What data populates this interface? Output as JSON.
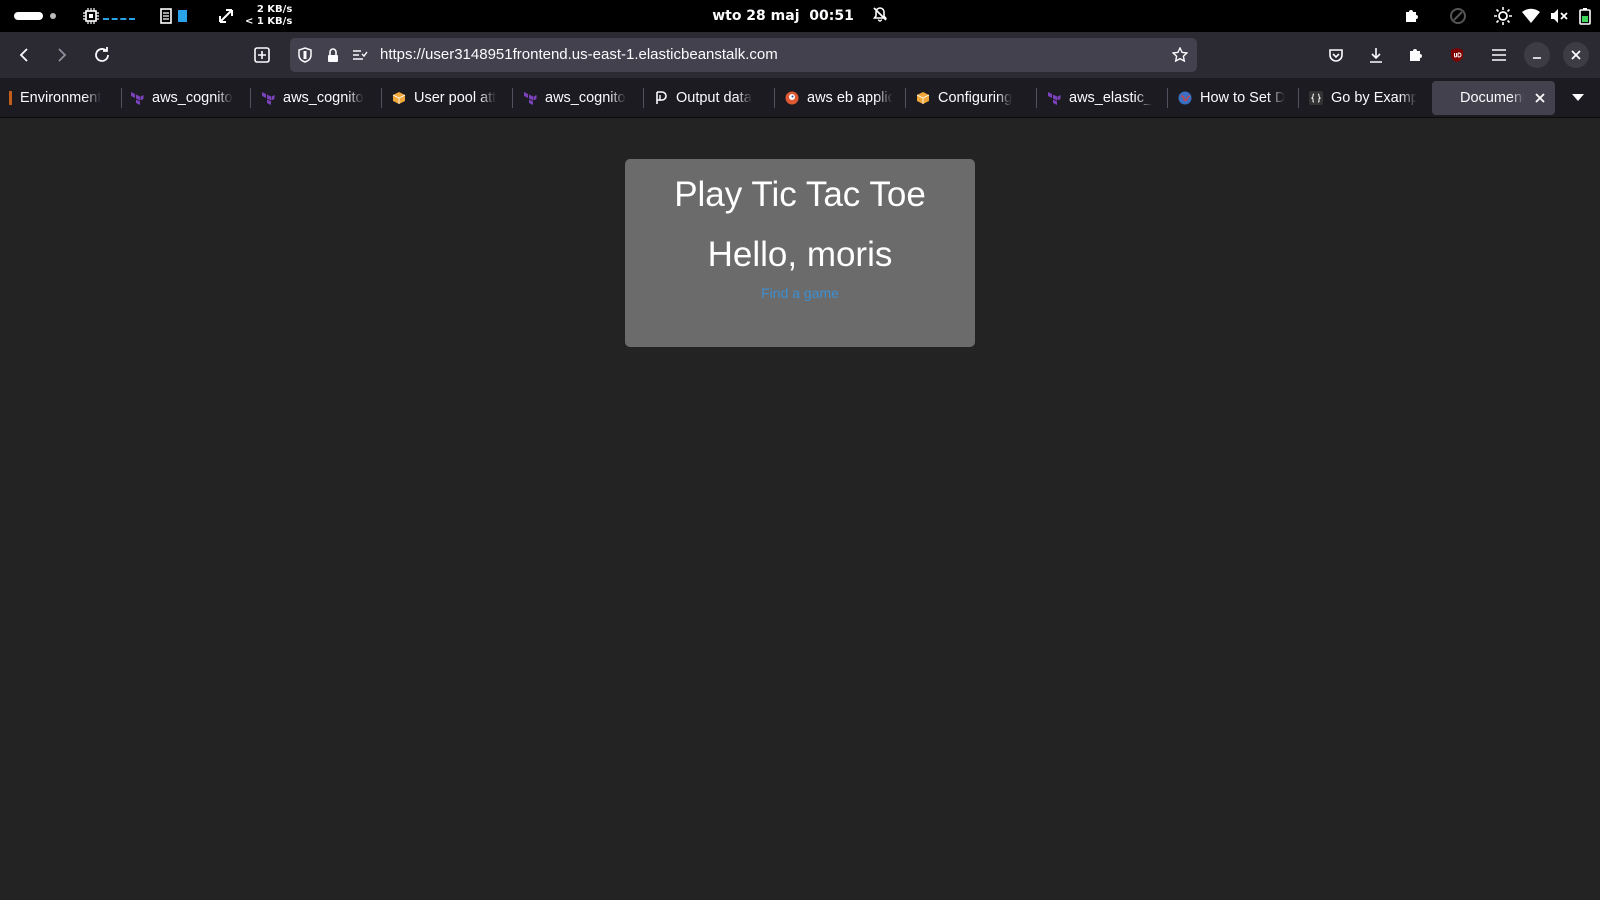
{
  "system_bar": {
    "net_up": "2 KB/s",
    "net_down": "< 1 KB/s",
    "datetime": "wto 28 maj  00:51",
    "accent_color": "#29a3e6"
  },
  "browser": {
    "url": "https://user3148951frontend.us-east-1.elasticbeanstalk.com",
    "tabs": [
      {
        "label": "Environment",
        "icon": "orange-app-icon"
      },
      {
        "label": "aws_cognito",
        "icon": "terraform-icon"
      },
      {
        "label": "aws_cognito",
        "icon": "terraform-icon"
      },
      {
        "label": "User pool att",
        "icon": "aws-box-icon"
      },
      {
        "label": "aws_cognito",
        "icon": "terraform-icon"
      },
      {
        "label": "Output data",
        "icon": "pulumi-icon"
      },
      {
        "label": "aws eb applic",
        "icon": "duckduckgo-icon"
      },
      {
        "label": "Configuring",
        "icon": "aws-box-icon"
      },
      {
        "label": "aws_elastic_",
        "icon": "terraform-icon"
      },
      {
        "label": "How to Set D",
        "icon": "globe-icon"
      },
      {
        "label": "Go by Examp",
        "icon": "code-braces-icon"
      }
    ],
    "active_tab": {
      "label": "Document",
      "close_label": "×"
    }
  },
  "page": {
    "title": "Play Tic Tac Toe",
    "greeting": "Hello, moris",
    "link_label": "Find a game",
    "card_color": "#6b6b6b",
    "link_color": "#3d8fd1"
  }
}
